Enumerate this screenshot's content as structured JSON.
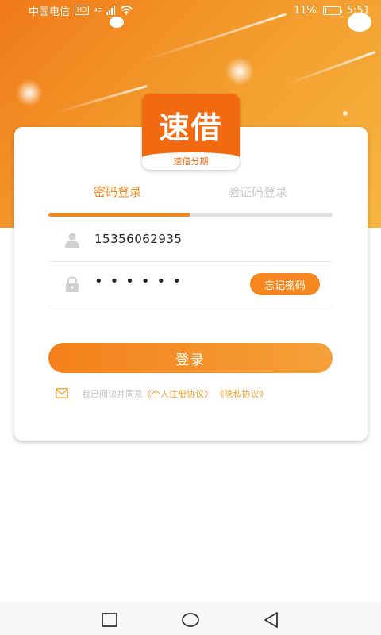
{
  "status_bar": {
    "carrier": "中国电信",
    "hd_badge": "HD",
    "network": "4G",
    "battery": "11%",
    "battery_level": 0.11,
    "time": "5:51"
  },
  "logo": {
    "brand": "速借",
    "subtitle": "速借分期",
    "color": "#f26a10"
  },
  "tabs": [
    {
      "label": "密码登录",
      "active": true
    },
    {
      "label": "验证码登录",
      "active": false
    }
  ],
  "form": {
    "phone_value": "15356062935",
    "password_masked": "••••••",
    "forgot_label": "忘记密码",
    "login_label": "登录"
  },
  "agreement": {
    "prefix": "我已阅读并同意",
    "user_agreement": "《个人注册协议》",
    "privacy_policy": "《隐私协议》"
  },
  "colors": {
    "accent": "#f5861a",
    "inactive_tab": "#c8c8c8"
  },
  "icons": {
    "user": "user-icon",
    "lock": "lock-icon",
    "checkbox": "checkbox-icon",
    "nav_recent": "square-icon",
    "nav_home": "circle-icon",
    "nav_back": "triangle-back-icon"
  }
}
